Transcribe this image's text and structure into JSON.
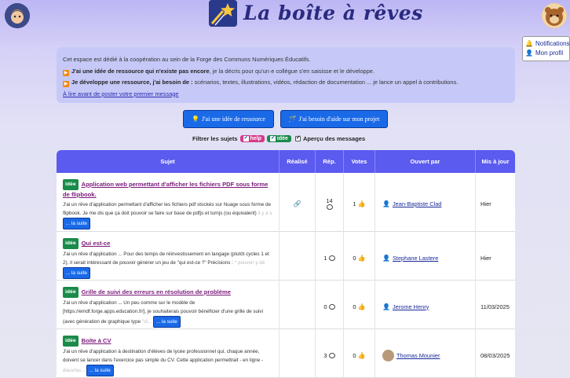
{
  "header": {
    "site_title": "La boîte à rêves",
    "user_menu": [
      {
        "icon": "bell-icon",
        "label": "Notifications"
      },
      {
        "icon": "person-icon",
        "label": "Mon profil"
      }
    ]
  },
  "info": {
    "intro": "Cet espace est dédié à la coopération au sein de la Forge des Communs Numériques Éducatifs.",
    "line1_bold": "J'ai une idée de ressource qui n'existe pas encore",
    "line1_rest": ", je la décris pour qu'un·e collègue s'en saisisse et le développe.",
    "line2_bold": "Je développe une ressource, j'ai besoin de :",
    "line2_rest": " scénarios, textes, illustrations, vidéos, rédaction de documentation ... je lance un appel à contributions.",
    "read_first_link": "À lire avant de poster votre premier message"
  },
  "actions": {
    "idea_button": "J'ai une idée de ressource",
    "help_button": "J'ai besoin d'aide sur mon projet"
  },
  "filters": {
    "label": "Filtrer les sujets",
    "help_tag": "help",
    "idee_tag": "idée",
    "preview_label": "Aperçu des messages"
  },
  "table": {
    "columns": [
      "Sujet",
      "Réalisé",
      "Rép.",
      "Votes",
      "Ouvert par",
      "Mis à jour"
    ],
    "more_label": "... la suite",
    "rows": [
      {
        "tag": "idée",
        "title": "Application web permettant d'afficher les fichiers PDF sous forme de flipbook.",
        "desc": "J'ai un rêve d'application permettant d'afficher les fichiers pdf stockés sur Nuage sous forme de flipbook. Je me dis que ça doit pouvoir se faire sur base de pdfjs et turnjs (ou équivalent)",
        "desc_fade": "il y a s",
        "realise": "link",
        "replies": "14",
        "votes": "1",
        "author": "Jean-Baptiste Clad",
        "updated": "Hier"
      },
      {
        "tag": "idée",
        "title": "Qui est-ce",
        "desc": "J'ai un rêve d'application ... Pour des temps de réinvestissement en langage (plutôt cycles 1 et 2), il serait intéressant de pouvoir générer un jeu de \"qui est-ce ?\" Précisions :",
        "desc_fade": "* pouvoir y dé",
        "realise": "",
        "replies": "1",
        "votes": "0",
        "author": "Stephane Lastere",
        "updated": "Hier"
      },
      {
        "tag": "idée",
        "title": "Grille de suivi des erreurs en résolution de problème",
        "desc": "J'ai un rêve d'application ... Un peu comme sur le modèle de [https://emdf.forge.apps.education.fr/], je souhaiterais pouvoir bénéficier d'une grille de suivi (avec génération de graphique type",
        "desc_fade": "\"di...",
        "realise": "",
        "replies": "0",
        "votes": "0",
        "author": "Jerome Henry",
        "updated": "11/03/2025"
      },
      {
        "tag": "idée",
        "title": "Boîte à CV",
        "desc": "J'ai un rêve d'application à destination d'élèves de lycée professionnel qui, chaque année, doivent se lancer dans l'exercice pas simple du CV. Cette application permettrait - en ligne -",
        "desc_fade": "douvrou...",
        "realise": "",
        "replies": "3",
        "votes": "0",
        "author": "Thomas Mounier",
        "updated": "08/03/2025"
      }
    ]
  }
}
